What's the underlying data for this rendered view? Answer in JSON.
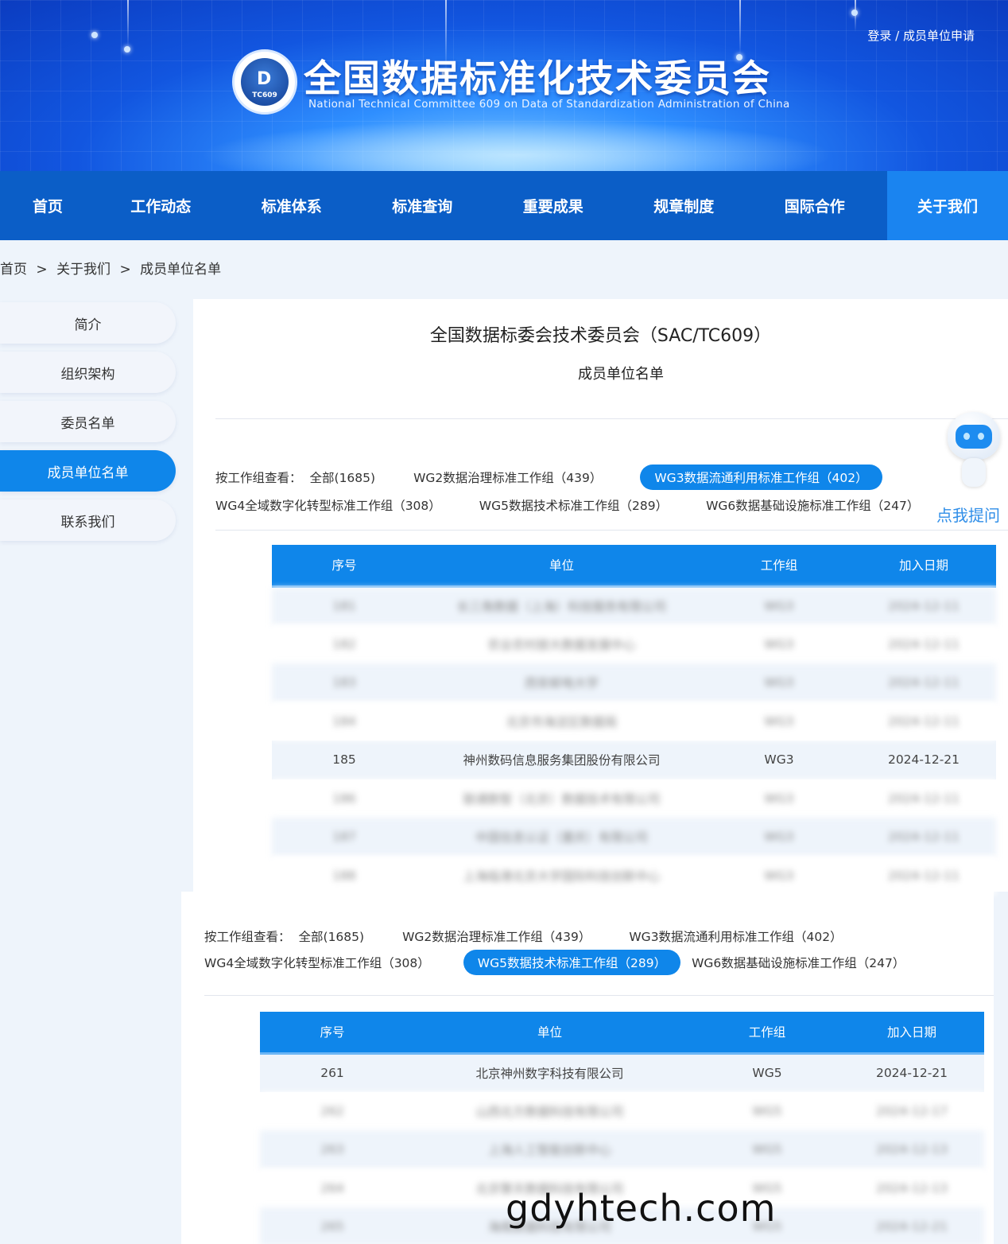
{
  "header": {
    "login_text": "登录 / 成员单位申请",
    "title": "全国数据标准化技术委员会",
    "subtitle": "National Technical Committee 609 on Data of Standardization Administration of China",
    "logo_text": "TC609"
  },
  "nav": [
    "首页",
    "工作动态",
    "标准体系",
    "标准查询",
    "重要成果",
    "规章制度",
    "国际合作",
    "关于我们"
  ],
  "breadcrumb": [
    "首页",
    ">",
    "关于我们",
    ">",
    "成员单位名单"
  ],
  "sidebar": [
    "简介",
    "组织架构",
    "委员名单",
    "成员单位名单",
    "联系我们"
  ],
  "main": {
    "title": "全国数据标委会技术委员会（SAC/TC609）",
    "subtitle": "成员单位名单"
  },
  "filter_label": "按工作组查看：",
  "filters": [
    "全部(1685)",
    "WG2数据治理标准工作组（439）",
    "WG3数据流通利用标准工作组（402）",
    "WG4全域数字化转型标准工作组（308）",
    "WG5数据技术标准工作组（289）",
    "WG6数据基础设施标准工作组（247）"
  ],
  "table_headers": [
    "序号",
    "单位",
    "工作组",
    "加入日期"
  ],
  "table1_rows": [
    [
      "181",
      "长三角数据（上海）科技服务有限公司",
      "WG3",
      "2024-12-11"
    ],
    [
      "182",
      "农业农村部大数据发展中心",
      "WG3",
      "2024-12-11"
    ],
    [
      "183",
      "西安邮电大学",
      "WG3",
      "2024-12-11"
    ],
    [
      "184",
      "北京市海淀区数据局",
      "WG3",
      "2024-12-11"
    ],
    [
      "185",
      "神州数码信息服务集团股份有限公司",
      "WG3",
      "2024-12-21"
    ],
    [
      "186",
      "联通数智（北京）数据技术有限公司",
      "WG3",
      "2024-12-11"
    ],
    [
      "187",
      "中国信息认证（重庆）有限公司",
      "WG3",
      "2024-12-11"
    ],
    [
      "188",
      "上海临港北京大学国际科技创新中心",
      "WG3",
      "2024-12-11"
    ]
  ],
  "table2_rows": [
    [
      "261",
      "北京神州数字科技有限公司",
      "WG5",
      "2024-12-21"
    ],
    [
      "262",
      "山西北方数据科技有限公司",
      "WG5",
      "2024-12-17"
    ],
    [
      "263",
      "上海人工智能创新中心",
      "WG5",
      "2024-12-13"
    ],
    [
      "264",
      "北京擎天数据科技有限公司",
      "WG5",
      "2024-12-13"
    ],
    [
      "265",
      "海南数据科技有限公司",
      "WG5",
      "2024-12-21"
    ]
  ],
  "assistant_label": "点我提问",
  "watermark": "gdyhtech.com"
}
